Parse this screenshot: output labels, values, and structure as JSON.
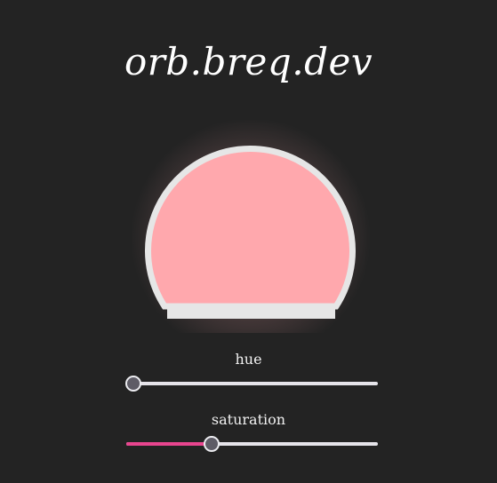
{
  "header": {
    "title": "orb.breq.dev"
  },
  "orb": {
    "color": "#ffa8ad",
    "glass_color": "#e6e6e6"
  },
  "controls": {
    "hue": {
      "label": "hue",
      "value": 0.03
    },
    "saturation": {
      "label": "saturation",
      "value": 0.34,
      "accent": "#e8458f"
    }
  }
}
